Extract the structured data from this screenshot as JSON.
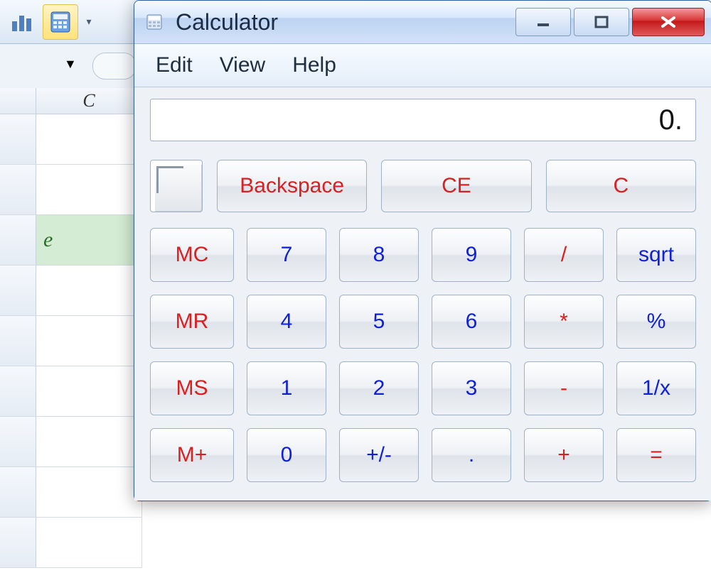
{
  "background": {
    "column_header": "C",
    "highlighted_cell_value": "e"
  },
  "window": {
    "title": "Calculator",
    "menu": {
      "edit": "Edit",
      "view": "View",
      "help": "Help"
    },
    "display_value": "0.",
    "top_buttons": {
      "backspace": "Backspace",
      "ce": "CE",
      "clear": "C"
    },
    "mem": {
      "mc": "MC",
      "mr": "MR",
      "ms": "MS",
      "mplus": "M+"
    },
    "digits": {
      "d7": "7",
      "d8": "8",
      "d9": "9",
      "d4": "4",
      "d5": "5",
      "d6": "6",
      "d1": "1",
      "d2": "2",
      "d3": "3",
      "d0": "0"
    },
    "ops": {
      "div": "/",
      "mul": "*",
      "sub": "-",
      "add": "+",
      "sqrt": "sqrt",
      "pct": "%",
      "recip": "1/x",
      "eq": "=",
      "sign": "+/-",
      "dot": "."
    }
  }
}
